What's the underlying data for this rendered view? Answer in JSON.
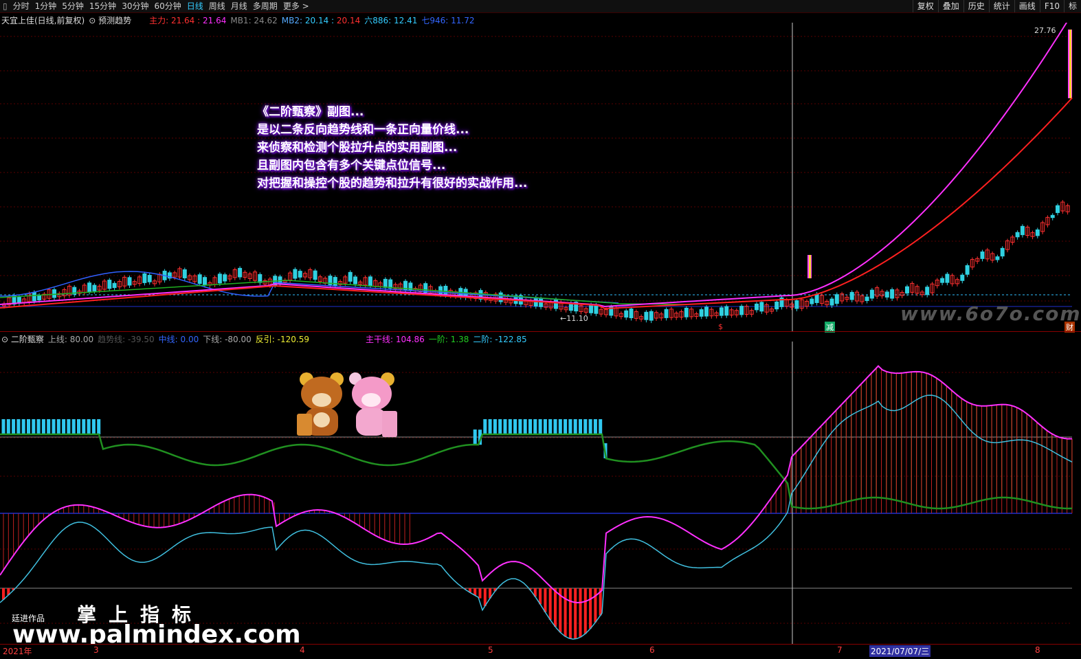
{
  "topbar": {
    "tabs": [
      "分时",
      "1分钟",
      "5分钟",
      "15分钟",
      "30分钟",
      "60分钟",
      "日线",
      "周线",
      "月线",
      "多周期",
      "更多 >"
    ],
    "active_tab": "日线",
    "right_buttons": [
      "复权",
      "叠加",
      "历史",
      "统计",
      "画线",
      "F10",
      "标"
    ]
  },
  "main_info": {
    "stock": "天宜上佳(日线,前复权)",
    "predict": "预测趋势",
    "zhuli_label": "主力:",
    "zhuli_v1": "21.64",
    "zhuli_v2": "21.64",
    "mb1": "MB1: 24.62",
    "mb2_label": "MB2:",
    "mb2_v1": "20.14",
    "mb2_v2": "20.14",
    "liu": "六886: 12.41",
    "qi": "七946: 11.72"
  },
  "main_chart": {
    "high_label": "27.76",
    "low_label": "←11.10",
    "marker_s": "$",
    "marker_jian": "减",
    "marker_cai": "财"
  },
  "annotation": [
    "《二阶甄察》副图...",
    "是以二条反向趋势线和一条正向量价线...",
    "来侦察和检测个股拉升点的实用副图...",
    "且副图内包含有多个关键点位信号...",
    "对把握和操控个股的趋势和拉升有很好的实战作用..."
  ],
  "watermark": "www.6o7o.com",
  "sub_info": {
    "name": "二阶甄察",
    "shang": "上线: 80.00",
    "qushi": "趋势线: -39.50",
    "zhong": "中线: 0.00",
    "xia": "下线: -80.00",
    "fanyin": "反引: -120.59",
    "zhugan": "主干线: 104.86",
    "yijie": "一阶: 1.38",
    "erjie": "二阶: -122.85"
  },
  "brand": {
    "author": "廷进作品",
    "cn": "掌上指标",
    "url": "www.palmindex.com"
  },
  "datebar": {
    "year": "2021年",
    "m3": "3",
    "m4": "4",
    "m5": "5",
    "m6": "6",
    "m7": "7",
    "cursor_date": "2021/07/07/三",
    "m8": "8"
  },
  "colors": {
    "up": "#ff3030",
    "down": "#30d0e0",
    "ma_magenta": "#ff30ff",
    "ma_red": "#ff2020",
    "ma_green": "#20b020",
    "ma_blue": "#3060ff"
  }
}
